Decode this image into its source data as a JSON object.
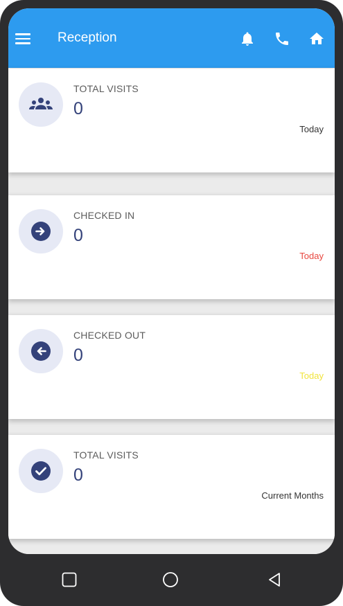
{
  "appbar": {
    "title": "Reception",
    "menu_icon": "menu-icon",
    "actions": [
      "bell-icon",
      "phone-icon",
      "home-icon"
    ],
    "color": "#2d9bef"
  },
  "cards": [
    {
      "label": "TOTAL VISITS",
      "value": "0",
      "period": "Today",
      "period_color": "#333333",
      "icon": "group-icon"
    },
    {
      "label": "CHECKED IN",
      "value": "0",
      "period": "Today",
      "period_color": "#e8463e",
      "icon": "arrow-right-circle-icon"
    },
    {
      "label": "CHECKED OUT",
      "value": "0",
      "period": "Today",
      "period_color": "#f1e43b",
      "icon": "arrow-left-circle-icon"
    },
    {
      "label": "TOTAL VISITS",
      "value": "0",
      "period": "Current Months",
      "period_color": "#333333",
      "icon": "check-circle-icon"
    }
  ],
  "colors": {
    "icon_fg": "#34427a",
    "icon_bg": "#e6e9f5"
  },
  "navbar": {
    "buttons": [
      "recent-apps-icon",
      "home-circle-icon",
      "back-icon"
    ]
  }
}
